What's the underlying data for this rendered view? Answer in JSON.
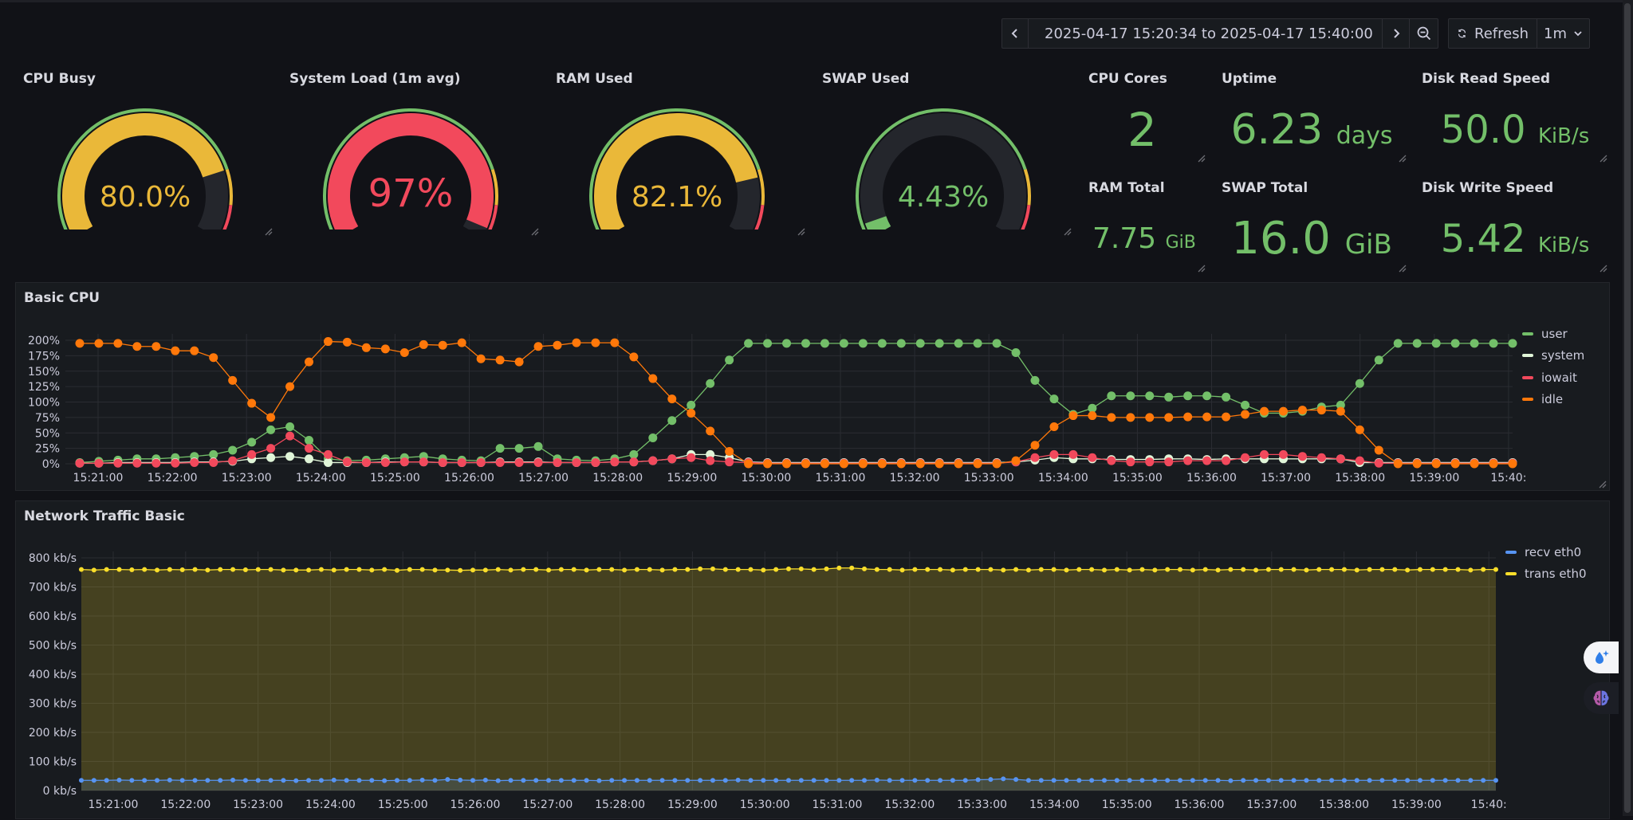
{
  "toolbar": {
    "time_range": "2025-04-17 15:20:34 to 2025-04-17 15:40:00",
    "refresh_label": "Refresh",
    "refresh_interval": "1m"
  },
  "gauges": [
    {
      "title": "CPU Busy",
      "display": "80.0%",
      "value": 80.0,
      "max": 100,
      "color": "#eab839"
    },
    {
      "title": "System Load (1m avg)",
      "display": "97%",
      "value": 97,
      "max": 100,
      "color": "#f2495c"
    },
    {
      "title": "RAM Used",
      "display": "82.1%",
      "value": 82.1,
      "max": 100,
      "color": "#eab839"
    },
    {
      "title": "SWAP Used",
      "display": "4.43%",
      "value": 4.43,
      "max": 100,
      "color": "#73bf69"
    }
  ],
  "stats": {
    "cpu_cores": {
      "title": "CPU Cores",
      "value": "2",
      "unit": ""
    },
    "uptime": {
      "title": "Uptime",
      "value": "6.23",
      "unit": "days"
    },
    "disk_read": {
      "title": "Disk Read Speed",
      "value": "50.0",
      "unit": "KiB/s"
    },
    "ram_total": {
      "title": "RAM Total",
      "value": "7.75",
      "unit": "GiB"
    },
    "swap_total": {
      "title": "SWAP Total",
      "value": "16.0",
      "unit": "GiB"
    },
    "disk_write": {
      "title": "Disk Write Speed",
      "value": "5.42",
      "unit": "KiB/s"
    }
  },
  "colors": {
    "green": "#73bf69",
    "yellow": "#eab839",
    "red": "#f2495c",
    "orange": "#ff780a",
    "system_white": "#e0f5d8",
    "blue": "#5794f2",
    "traffic_yellow": "#fade2a"
  },
  "cpu_panel": {
    "title": "Basic CPU",
    "y_ticks": [
      "200%",
      "175%",
      "150%",
      "125%",
      "100%",
      "75%",
      "50%",
      "25%",
      "0%"
    ],
    "x_ticks": [
      "15:21:00",
      "15:22:00",
      "15:23:00",
      "15:24:00",
      "15:25:00",
      "15:26:00",
      "15:27:00",
      "15:28:00",
      "15:29:00",
      "15:30:00",
      "15:31:00",
      "15:32:00",
      "15:33:00",
      "15:34:00",
      "15:35:00",
      "15:36:00",
      "15:37:00",
      "15:38:00",
      "15:39:00",
      "15:40:"
    ],
    "legend": [
      {
        "name": "user",
        "color": "#73bf69"
      },
      {
        "name": "system",
        "color": "#e0f5d8"
      },
      {
        "name": "iowait",
        "color": "#f2495c"
      },
      {
        "name": "idle",
        "color": "#ff780a"
      }
    ]
  },
  "net_panel": {
    "title": "Network Traffic Basic",
    "y_ticks": [
      "800 kb/s",
      "700 kb/s",
      "600 kb/s",
      "500 kb/s",
      "400 kb/s",
      "300 kb/s",
      "200 kb/s",
      "100 kb/s",
      "0 kb/s"
    ],
    "x_ticks": [
      "15:21:00",
      "15:22:00",
      "15:23:00",
      "15:24:00",
      "15:25:00",
      "15:26:00",
      "15:27:00",
      "15:28:00",
      "15:29:00",
      "15:30:00",
      "15:31:00",
      "15:32:00",
      "15:33:00",
      "15:34:00",
      "15:35:00",
      "15:36:00",
      "15:37:00",
      "15:38:00",
      "15:39:00",
      "15:40:"
    ],
    "legend": [
      {
        "name": "recv eth0",
        "color": "#5794f2"
      },
      {
        "name": "trans eth0",
        "color": "#fade2a"
      }
    ]
  },
  "chart_data": [
    {
      "type": "line",
      "title": "Basic CPU",
      "x": [
        "15:20:34",
        "15:20:54",
        "15:21:14",
        "15:21:34",
        "15:21:54",
        "15:22:14",
        "15:22:34",
        "15:22:54",
        "15:23:14",
        "15:23:34",
        "15:23:54",
        "15:24:14",
        "15:24:34",
        "15:24:54",
        "15:25:14",
        "15:25:34",
        "15:25:54",
        "15:26:14",
        "15:26:34",
        "15:26:54",
        "15:27:14",
        "15:27:34",
        "15:27:54",
        "15:28:14",
        "15:28:34",
        "15:28:54",
        "15:29:14",
        "15:29:34",
        "15:29:54",
        "15:30:14",
        "15:30:34",
        "15:30:54",
        "15:31:14",
        "15:31:34",
        "15:31:54",
        "15:32:14",
        "15:32:34",
        "15:32:54",
        "15:33:14",
        "15:33:34",
        "15:33:54",
        "15:34:14",
        "15:34:34",
        "15:34:54",
        "15:35:14",
        "15:35:34",
        "15:35:54",
        "15:36:14",
        "15:36:34",
        "15:36:54",
        "15:37:14",
        "15:37:34",
        "15:37:54",
        "15:38:14",
        "15:38:34",
        "15:38:54",
        "15:39:14",
        "15:39:34",
        "15:39:54",
        "15:40:00"
      ],
      "ylim": [
        0,
        200
      ],
      "series": [
        {
          "name": "user",
          "values": [
            2,
            4,
            6,
            8,
            8,
            10,
            12,
            15,
            22,
            35,
            55,
            60,
            38,
            8,
            5,
            6,
            8,
            10,
            12,
            8,
            6,
            5,
            25,
            25,
            28,
            8,
            6,
            5,
            8,
            15,
            42,
            70,
            95,
            130,
            168,
            195,
            195,
            195,
            195,
            195,
            195,
            195,
            195,
            195,
            195,
            195,
            195,
            195,
            195,
            180,
            135,
            105,
            80,
            90,
            110,
            110,
            110,
            108,
            110,
            110,
            108,
            95,
            82,
            82,
            85,
            92,
            95,
            130,
            168,
            195,
            195,
            195,
            195,
            195,
            195,
            195
          ]
        },
        {
          "name": "system",
          "values": [
            1,
            1,
            2,
            2,
            2,
            2,
            3,
            3,
            4,
            8,
            10,
            12,
            8,
            2,
            2,
            2,
            3,
            3,
            3,
            2,
            2,
            2,
            3,
            3,
            3,
            2,
            2,
            2,
            3,
            3,
            5,
            8,
            15,
            15,
            10,
            3,
            2,
            2,
            2,
            2,
            2,
            2,
            2,
            2,
            2,
            2,
            2,
            2,
            2,
            3,
            6,
            10,
            8,
            8,
            7,
            7,
            7,
            8,
            8,
            7,
            8,
            8,
            8,
            8,
            8,
            8,
            8,
            2,
            2,
            2,
            2,
            2,
            2,
            2,
            2,
            2
          ]
        },
        {
          "name": "iowait",
          "values": [
            1,
            1,
            1,
            1,
            1,
            1,
            2,
            2,
            5,
            15,
            25,
            45,
            25,
            15,
            3,
            2,
            2,
            3,
            3,
            2,
            2,
            2,
            2,
            2,
            2,
            2,
            2,
            2,
            3,
            3,
            5,
            8,
            10,
            5,
            3,
            2,
            1,
            1,
            1,
            1,
            1,
            1,
            1,
            1,
            1,
            1,
            1,
            1,
            1,
            3,
            10,
            15,
            15,
            10,
            5,
            3,
            3,
            3,
            5,
            5,
            5,
            10,
            15,
            15,
            12,
            10,
            8,
            5,
            1,
            1,
            1,
            1,
            1,
            1,
            1,
            1
          ]
        },
        {
          "name": "idle",
          "values": [
            195,
            195,
            195,
            190,
            190,
            183,
            183,
            172,
            135,
            98,
            75,
            125,
            165,
            198,
            197,
            188,
            186,
            180,
            193,
            192,
            196,
            170,
            168,
            165,
            190,
            192,
            196,
            196,
            196,
            173,
            138,
            105,
            82,
            53,
            20,
            0,
            0,
            0,
            0,
            0,
            0,
            0,
            0,
            0,
            0,
            0,
            0,
            0,
            0,
            5,
            30,
            60,
            78,
            78,
            75,
            75,
            75,
            75,
            76,
            76,
            76,
            80,
            85,
            85,
            87,
            87,
            85,
            55,
            22,
            0,
            0,
            0,
            0,
            0,
            0,
            0
          ]
        }
      ]
    },
    {
      "type": "area",
      "title": "Network Traffic Basic",
      "x_range": [
        "15:20:34",
        "15:40:00"
      ],
      "ylim": [
        0,
        800
      ],
      "series": [
        {
          "name": "recv eth0",
          "values": [
            35,
            35,
            35,
            36,
            35,
            35,
            35,
            36,
            35,
            35,
            35,
            35,
            36,
            35,
            35,
            35,
            35,
            34,
            35,
            35,
            36,
            35,
            35,
            35,
            34,
            35,
            35,
            36,
            35,
            38,
            36,
            35,
            36,
            34,
            35,
            35,
            35,
            35,
            35,
            35,
            35,
            34,
            35,
            35,
            35,
            35,
            35,
            35,
            35,
            35,
            35,
            35,
            36,
            35,
            35,
            35,
            35,
            35,
            35,
            35,
            35,
            35,
            35,
            36,
            35,
            35,
            35,
            35,
            35,
            35,
            35,
            37,
            38,
            40,
            38,
            35,
            35,
            35,
            35,
            35,
            35,
            35,
            35,
            35,
            35,
            35,
            35,
            35,
            35,
            35,
            35,
            34,
            35,
            35,
            35,
            35,
            35,
            35,
            35,
            35,
            35,
            35,
            35,
            35,
            35,
            35,
            35,
            35,
            35,
            35,
            35,
            35,
            35
          ]
        },
        {
          "name": "trans eth0",
          "values": [
            760,
            758,
            760,
            760,
            759,
            760,
            758,
            760,
            759,
            760,
            758,
            760,
            760,
            759,
            760,
            760,
            758,
            758,
            758,
            760,
            758,
            760,
            760,
            758,
            760,
            757,
            760,
            760,
            758,
            758,
            757,
            758,
            758,
            760,
            758,
            760,
            760,
            758,
            760,
            760,
            758,
            760,
            760,
            758,
            760,
            760,
            758,
            760,
            760,
            762,
            762,
            760,
            760,
            760,
            758,
            760,
            762,
            762,
            760,
            762,
            765,
            765,
            762,
            760,
            760,
            758,
            760,
            760,
            760,
            758,
            760,
            760,
            760,
            758,
            760,
            758,
            760,
            760,
            758,
            760,
            760,
            758,
            760,
            758,
            760,
            758,
            760,
            760,
            758,
            760,
            758,
            760,
            760,
            758,
            760,
            760,
            760,
            758,
            760,
            760,
            760,
            758,
            760,
            760,
            760,
            758,
            760,
            760,
            760,
            760,
            758,
            760,
            760
          ]
        }
      ]
    }
  ]
}
